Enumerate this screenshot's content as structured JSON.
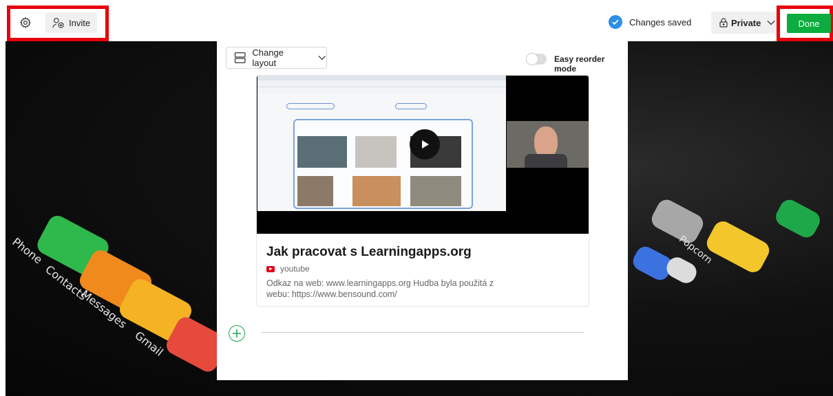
{
  "toolbar": {
    "invite_label": "Invite",
    "status_text": "Changes saved",
    "privacy_label": "Private",
    "done_label": "Done"
  },
  "panel": {
    "change_layout_label": "Change layout",
    "easy_reorder_label": "Easy reorder mode",
    "easy_reorder_enabled": false
  },
  "post": {
    "title": "Jak pracovat s Learningapps.org",
    "source": "youtube",
    "description": "Odkaz na web: www.learningapps.org Hudba byla použitá z webu: https://www.bensound.com/"
  },
  "background": {
    "labels": [
      "Phone",
      "Contacts",
      "Messages",
      "Gmail",
      "Popcorn"
    ]
  },
  "colors": {
    "accent_blue": "#2b8fe6",
    "done_green": "#0aad3e",
    "highlight_red": "#e8000b",
    "add_green": "#1aa34a"
  },
  "icons": [
    "gear-icon",
    "add-user-icon",
    "check-circle-icon",
    "lock-icon",
    "chevron-down-icon",
    "layout-icon",
    "play-icon",
    "youtube-icon",
    "add-circle-icon"
  ]
}
